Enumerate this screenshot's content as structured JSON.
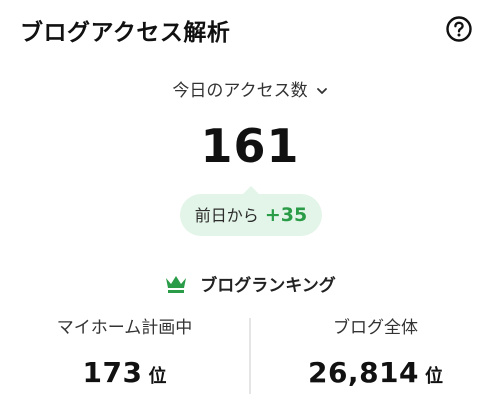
{
  "header": {
    "title": "ブログアクセス解析",
    "help_icon": "question-circle-icon"
  },
  "metric": {
    "selected": "今日のアクセス数",
    "dropdown_icon": "chevron-down-icon",
    "count": "161"
  },
  "diff": {
    "label": "前日から",
    "value": "+35",
    "color": "#2a9c47",
    "background": "#e3f5e8"
  },
  "ranking": {
    "heading": "ブログランキング",
    "icon": "crown-icon",
    "icon_color": "#2a9c47",
    "items": [
      {
        "label": "マイホーム計画中",
        "value": "173",
        "unit": "位"
      },
      {
        "label": "ブログ全体",
        "value": "26,814",
        "unit": "位"
      }
    ]
  }
}
